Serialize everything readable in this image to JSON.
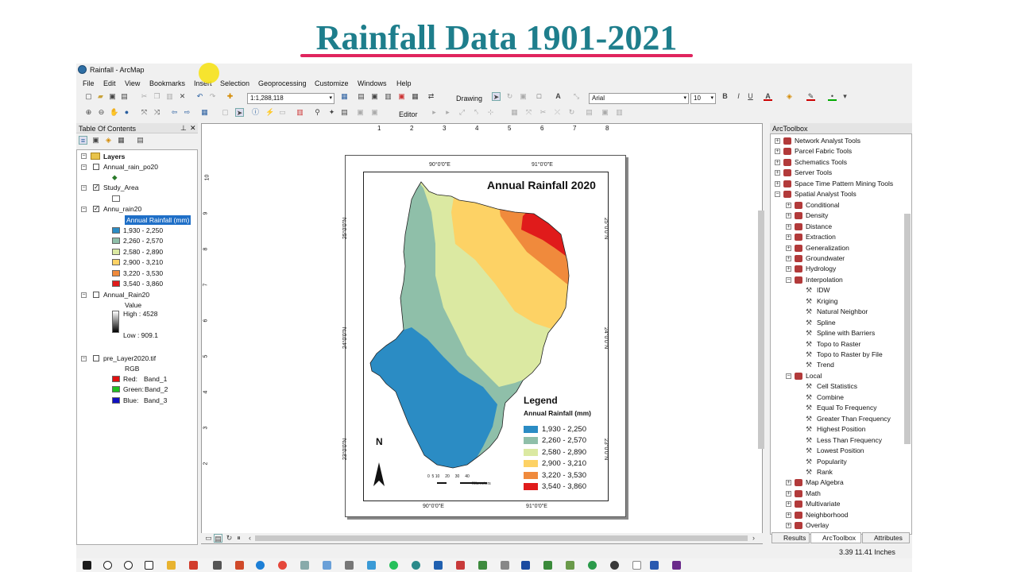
{
  "banner": {
    "title": "Rainfall Data 1901-2021"
  },
  "window": {
    "title": "Rainfall - ArcMap"
  },
  "menu": [
    "File",
    "Edit",
    "View",
    "Bookmarks",
    "Insert",
    "Selection",
    "Geoprocessing",
    "Customize",
    "Windows",
    "Help"
  ],
  "toolbar": {
    "scale": "1:1,288,118",
    "drawing_label": "Drawing",
    "font": "Arial",
    "font_size": "10",
    "editor_label": "Editor",
    "bold": "B",
    "italic": "I",
    "underline": "U",
    "text_color_letter": "A"
  },
  "toc": {
    "title": "Table Of Contents",
    "root": "Layers",
    "layers": [
      {
        "name": "Annual_rain_po20",
        "checked": false
      },
      {
        "name": "Study_Area",
        "checked": true
      },
      {
        "name": "Annu_rain20",
        "checked": true,
        "field": "Annual Rainfall (mm)"
      },
      {
        "name": "Annual_Rain20",
        "checked": false,
        "value_label": "Value",
        "high": "High : 4528",
        "low": "Low : 909.1"
      },
      {
        "name": "pre_Layer2020.tif",
        "checked": false,
        "rgb_label": "RGB",
        "bands": [
          {
            "channel": "Red:",
            "band": "Band_1",
            "color": "#e01010"
          },
          {
            "channel": "Green:",
            "band": "Band_2",
            "color": "#20c020"
          },
          {
            "channel": "Blue:",
            "band": "Band_3",
            "color": "#1010c0"
          }
        ]
      }
    ],
    "classes": [
      {
        "label": "1,930 - 2,250",
        "color": "#2b8cc4"
      },
      {
        "label": "2,260 - 2,570",
        "color": "#8fbfa9"
      },
      {
        "label": "2,580 - 2,890",
        "color": "#dbe9a2"
      },
      {
        "label": "2,900 - 3,210",
        "color": "#fdd265"
      },
      {
        "label": "3,220 - 3,530",
        "color": "#f08a3c"
      },
      {
        "label": "3,540 - 3,860",
        "color": "#e01b1b"
      }
    ]
  },
  "ruler": {
    "h": [
      "1",
      "2",
      "3",
      "4",
      "5",
      "6",
      "7",
      "8"
    ],
    "v": [
      "10",
      "9",
      "8",
      "7",
      "6",
      "5",
      "4",
      "3",
      "2"
    ]
  },
  "map": {
    "title": "Annual Rainfall 2020",
    "top_labels": [
      "90°0'0\"E",
      "91°0'0\"E"
    ],
    "bottom_labels": [
      "90°0'0\"E",
      "91°0'0\"E"
    ],
    "left_labels": [
      "25°0'0\"N",
      "24°0'0\"N",
      "23°0'0\"N"
    ],
    "right_labels": [
      "25°0'0\"N",
      "24°0'0\"N",
      "23°0'0\"N"
    ],
    "north": "N",
    "scale_ticks": "0  5 10     20     30     40",
    "scale_unit": "Kilometers",
    "legend_title": "Legend",
    "legend_subtitle": "Annual Rainfall (mm)",
    "legend_items": [
      "1,930 - 2,250",
      "2,260 - 2,570",
      "2,580 - 2,890",
      "2,900 - 3,210",
      "3,220 - 3,530",
      "3,540 - 3,860"
    ]
  },
  "toolbox": {
    "title": "ArcToolbox",
    "top": [
      "Network Analyst Tools",
      "Parcel Fabric Tools",
      "Schematics Tools",
      "Server Tools",
      "Space Time Pattern Mining Tools",
      "Spatial Analyst Tools"
    ],
    "spatial": [
      "Conditional",
      "Density",
      "Distance",
      "Extraction",
      "Generalization",
      "Groundwater",
      "Hydrology",
      "Interpolation"
    ],
    "interpolation": [
      "IDW",
      "Kriging",
      "Natural Neighbor",
      "Spline",
      "Spline with Barriers",
      "Topo to Raster",
      "Topo to Raster by File",
      "Trend"
    ],
    "local_label": "Local",
    "local": [
      "Cell Statistics",
      "Combine",
      "Equal To Frequency",
      "Greater Than Frequency",
      "Highest Position",
      "Less Than Frequency",
      "Lowest Position",
      "Popularity",
      "Rank"
    ],
    "after": [
      "Map Algebra",
      "Math",
      "Multivariate",
      "Neighborhood",
      "Overlay"
    ],
    "tabs": [
      "Results",
      "ArcToolbox",
      "Attributes"
    ]
  },
  "status": {
    "coords": "3.39  11.41 Inches"
  }
}
